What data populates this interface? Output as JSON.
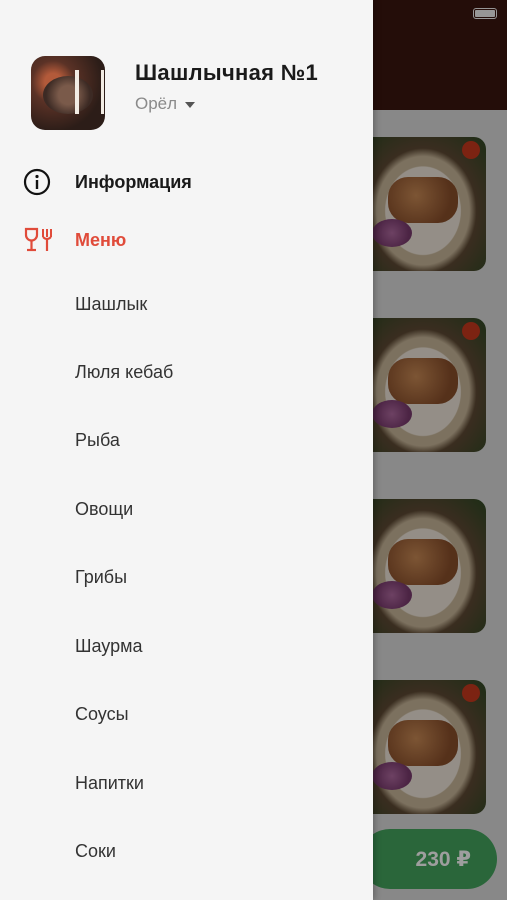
{
  "drawer": {
    "restaurant_name": "Шашлычная №1",
    "city": "Орёл",
    "nav": {
      "info_label": "Информация",
      "menu_label": "Меню"
    },
    "menu_categories": [
      "Шашлык",
      "Люля кебаб",
      "Рыба",
      "Овощи",
      "Грибы",
      "Шаурма",
      "Соусы",
      "Напитки",
      "Соки"
    ]
  },
  "background": {
    "cart_total": "230 ₽"
  },
  "colors": {
    "accent_red": "#e04b3a",
    "cart_green": "#44a55e",
    "header_dark": "#3a160f"
  },
  "icons": {
    "info": "info-circle-icon",
    "menu": "glass-fork-icon",
    "city_dropdown": "caret-down-icon"
  }
}
